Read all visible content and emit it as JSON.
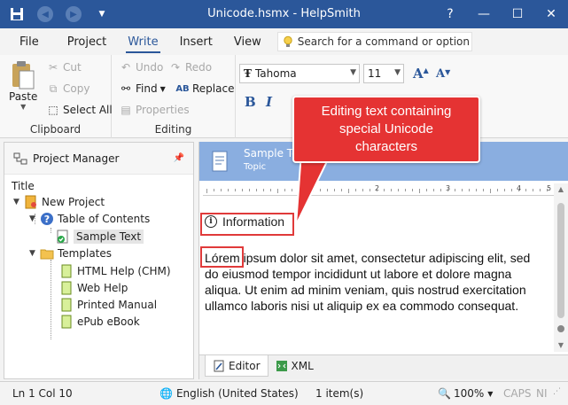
{
  "window": {
    "title": "Unicode.hsmx - HelpSmith",
    "controls": {
      "help": "?",
      "minimize": "—",
      "maximize": "☐",
      "close": "✕"
    }
  },
  "tabs": [
    {
      "label": "File"
    },
    {
      "label": "Project"
    },
    {
      "label": "Write"
    },
    {
      "label": "Insert"
    },
    {
      "label": "View"
    }
  ],
  "search": {
    "placeholder": "Search for a command or option"
  },
  "ribbon": {
    "clipboard": {
      "label": "Clipboard",
      "paste": "Paste",
      "cut": "Cut",
      "copy": "Copy",
      "select_all": "Select All"
    },
    "editing": {
      "label": "Editing",
      "undo": "Undo",
      "redo": "Redo",
      "find": "Find",
      "replace": "Replace",
      "properties": "Properties"
    },
    "font": {
      "name": "Tahoma",
      "size": "11",
      "bold": "B",
      "italic": "I"
    }
  },
  "project_manager": {
    "title": "Project Manager",
    "column": "Title",
    "tree": {
      "root": "New Project",
      "toc": "Table of Contents",
      "sample": "Sample Text",
      "templates": "Templates",
      "template_items": [
        "HTML Help (CHM)",
        "Web Help",
        "Printed Manual",
        "ePub eBook"
      ]
    }
  },
  "editor": {
    "topic_name": "Sample Text",
    "topic_type": "Topic",
    "ruler_nums": [
      "1",
      "2",
      "3",
      "4",
      "5"
    ],
    "heading": "Information",
    "first_word": "Lórem",
    "paragraph_rest": " ipsum dolor sit amet, consectetur adipiscing elit, sed do eiusmod tempor incididunt ut labore et dolore magna aliqua. Ut enim ad minim veniam, quis nostrud exercitation ullamco laboris nisi ut aliquip ex ea commodo consequat.",
    "tabs": [
      "Editor",
      "XML"
    ]
  },
  "callout": {
    "lines": [
      "Editing text containing",
      "special Unicode",
      "characters"
    ]
  },
  "status": {
    "position": "Ln 1 Col 10",
    "language": "English (United States)",
    "items": "1 item(s)",
    "zoom": "100%",
    "caps": "CAPS",
    "num": "NI"
  },
  "colors": {
    "accent": "#2b579a",
    "topic_header": "#8aaee0",
    "highlight": "#e53333"
  }
}
